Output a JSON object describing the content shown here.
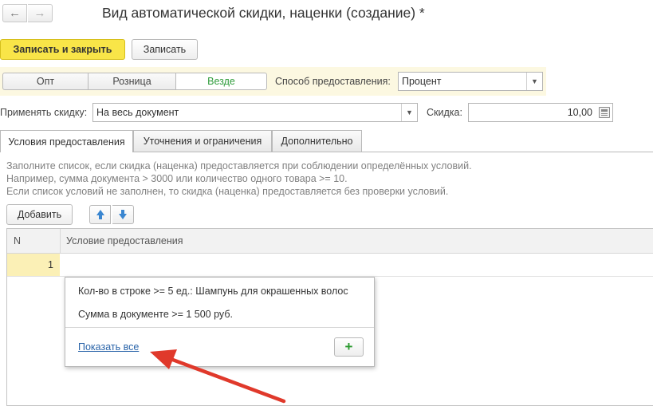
{
  "window": {
    "title": "Вид автоматической скидки, наценки (создание) *"
  },
  "toolbar": {
    "save_close_label": "Записать и закрыть",
    "save_label": "Записать"
  },
  "segments": {
    "opt": "Опт",
    "retail": "Розница",
    "everywhere": "Везде",
    "selected": "Везде"
  },
  "method": {
    "label": "Способ предоставления:",
    "value": "Процент"
  },
  "apply": {
    "label": "Применять скидку:",
    "value": "На весь документ"
  },
  "discount": {
    "label": "Скидка:",
    "value": "10,00"
  },
  "tabs": [
    {
      "label": "Условия предоставления",
      "active": true
    },
    {
      "label": "Уточнения и ограничения",
      "active": false
    },
    {
      "label": "Дополнительно",
      "active": false
    }
  ],
  "hint": {
    "line1": "Заполните список, если скидка (наценка) предоставляется при соблюдении определённых условий.",
    "line2": "Например, сумма документа > 3000 или количество одного товара >= 10.",
    "line3": "Если список условий не заполнен, то скидка (наценка) предоставляется без проверки условий."
  },
  "list_toolbar": {
    "add_label": "Добавить"
  },
  "table": {
    "columns": [
      "N",
      "Условие предоставления"
    ],
    "rows": [
      {
        "n": "1",
        "condition": ""
      }
    ]
  },
  "popup": {
    "items": [
      "Кол-во в строке >= 5 ед.: Шампунь для окрашенных волос",
      "Сумма в документе >= 1 500 руб."
    ],
    "show_all_label": "Показать все"
  },
  "colors": {
    "primary_button": "#f9e548",
    "selected_segment_text": "#2f9c3b",
    "highlight_band": "#fcf8e1",
    "active_row_cell": "#fbf0b6",
    "link": "#2a64a9",
    "annotation_arrow": "#e0392b"
  }
}
